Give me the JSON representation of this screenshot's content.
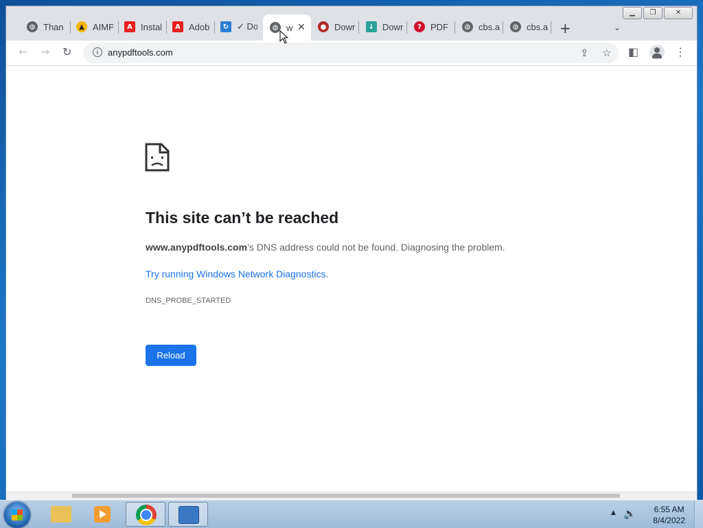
{
  "browser": {
    "tabs": [
      {
        "label": "Thank",
        "icon": "globe-icon"
      },
      {
        "label": "AIMP",
        "icon": "aimp-icon"
      },
      {
        "label": "Install",
        "icon": "adobe-icon"
      },
      {
        "label": "Adobe",
        "icon": "adobe-icon"
      },
      {
        "label": "✓ Do",
        "icon": "update-icon"
      },
      {
        "label": "w",
        "icon": "globe-icon",
        "active": true
      },
      {
        "label": "Down",
        "icon": "download-site-icon"
      },
      {
        "label": "Down",
        "icon": "download-site-icon"
      },
      {
        "label": "PDF",
        "icon": "pdf-icon"
      },
      {
        "label": "cbs.ar",
        "icon": "globe-icon"
      },
      {
        "label": "cbs.ar",
        "icon": "globe-icon"
      }
    ],
    "new_tab_symbol": "+",
    "url": "anypdftools.com"
  },
  "error_page": {
    "title": "This site can’t be reached",
    "host": "www.anypdftools.com",
    "description_suffix": "’s DNS address could not be found. Diagnosing the problem.",
    "link_text": "Try running Windows Network Diagnostics",
    "link_suffix": ".",
    "error_code": "DNS_PROBE_STARTED",
    "reload_label": "Reload"
  },
  "taskbar": {
    "time": "6:55 AM",
    "date": "8/4/2022"
  },
  "colors": {
    "accent": "#1a73e8",
    "tabstrip": "#dee1e6"
  }
}
